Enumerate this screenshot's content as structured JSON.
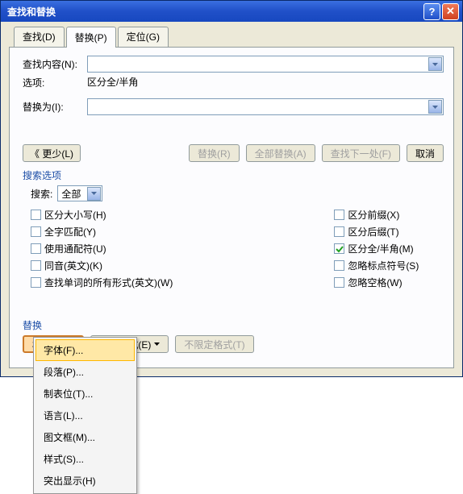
{
  "title": "查找和替换",
  "tabs": {
    "find": "查找(D)",
    "replace": "替换(P)",
    "goto": "定位(G)"
  },
  "find_label": "查找内容(N):",
  "options_label": "选项:",
  "options_value": "区分全/半角",
  "replace_label": "替换为(I):",
  "buttons": {
    "less": "《 更少(L)",
    "replace": "替换(R)",
    "replace_all": "全部替换(A)",
    "find_next": "查找下一处(F)",
    "cancel": "取消"
  },
  "search_options_title": "搜索选项",
  "search_label": "搜索:",
  "search_value": "全部",
  "cb": {
    "case": "区分大小写(H)",
    "whole": "全字匹配(Y)",
    "wildcard": "使用通配符(U)",
    "homophone": "同音(英文)(K)",
    "forms": "查找单词的所有形式(英文)(W)",
    "prefix": "区分前缀(X)",
    "suffix": "区分后缀(T)",
    "width": "区分全/半角(M)",
    "punct": "忽略标点符号(S)",
    "space": "忽略空格(W)"
  },
  "replace_section_title": "替换",
  "fmt_buttons": {
    "format": "格式(O)",
    "special": "特殊格式(E)",
    "noformat": "不限定格式(T)"
  },
  "menu": {
    "font": "字体(F)...",
    "para": "段落(P)...",
    "tab": "制表位(T)...",
    "lang": "语言(L)...",
    "frame": "图文框(M)...",
    "style": "样式(S)...",
    "hl": "突出显示(H)"
  }
}
